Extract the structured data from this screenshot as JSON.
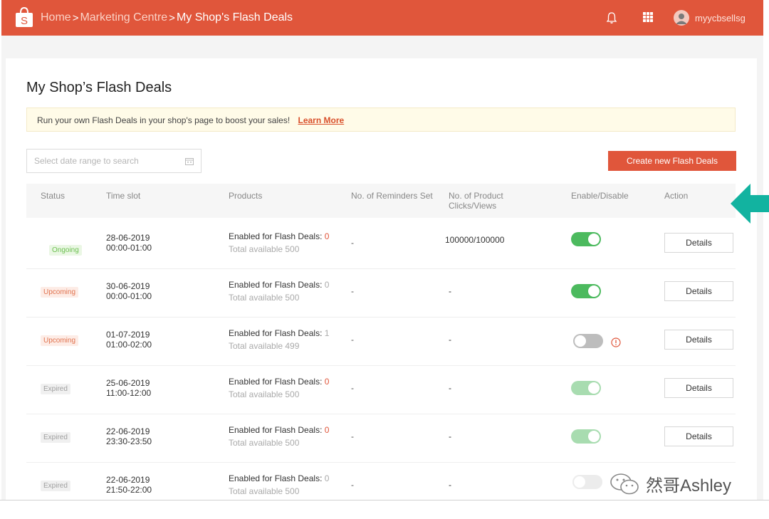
{
  "header": {
    "breadcrumb": [
      "Home",
      "Marketing Centre",
      "My Shop's Flash Deals"
    ],
    "separator": ">",
    "username": "myycbsellsg"
  },
  "page": {
    "title": "My Shop’s Flash Deals",
    "notice_text": "Run your own Flash Deals in your shop's page to boost your sales!",
    "learn_more": "Learn More",
    "date_placeholder": "Select date range to search",
    "create_button": "Create new Flash Deals"
  },
  "table": {
    "headers": {
      "status": "Status",
      "time_slot": "Time slot",
      "products": "Products",
      "reminders": "No. of Reminders Set",
      "clicks_line1": "No. of Product",
      "clicks_line2": "Clicks/Views",
      "enable": "Enable/Disable",
      "action": "Action"
    },
    "enabled_label": "Enabled for Flash Deals: ",
    "details_label": "Details",
    "rows": [
      {
        "status": "Ongoing",
        "date": "28-06-2019",
        "time": "00:00-01:00",
        "enabled": "0",
        "available": "Total available 500",
        "reminders": "-",
        "clicks": "100000/100000",
        "toggle": "on"
      },
      {
        "status": "Upcoming",
        "date": "30-06-2019",
        "time": "00:00-01:00",
        "enabled": "0",
        "available": "Total available 500",
        "reminders": "-",
        "clicks": "-",
        "toggle": "on"
      },
      {
        "status": "Upcoming",
        "date": "01-07-2019",
        "time": "01:00-02:00",
        "enabled": "1",
        "available": "Total available 499",
        "reminders": "-",
        "clicks": "-",
        "toggle": "off"
      },
      {
        "status": "Expired",
        "date": "25-06-2019",
        "time": "11:00-12:00",
        "enabled": "0",
        "available": "Total available 500",
        "reminders": "-",
        "clicks": "-",
        "toggle": "on-dim"
      },
      {
        "status": "Expired",
        "date": "22-06-2019",
        "time": "23:30-23:50",
        "enabled": "0",
        "available": "Total available 500",
        "reminders": "-",
        "clicks": "-",
        "toggle": "on-dim"
      },
      {
        "status": "Expired",
        "date": "22-06-2019",
        "time": "21:50-22:00",
        "enabled": "0",
        "available": "Total available 500",
        "reminders": "-",
        "clicks": "-",
        "toggle": "off-dim"
      }
    ]
  },
  "watermark": "然哥Ashley",
  "colors": {
    "brand": "#e0563b",
    "toggle_on": "#4cba5e",
    "arrow": "#12b3a0"
  }
}
